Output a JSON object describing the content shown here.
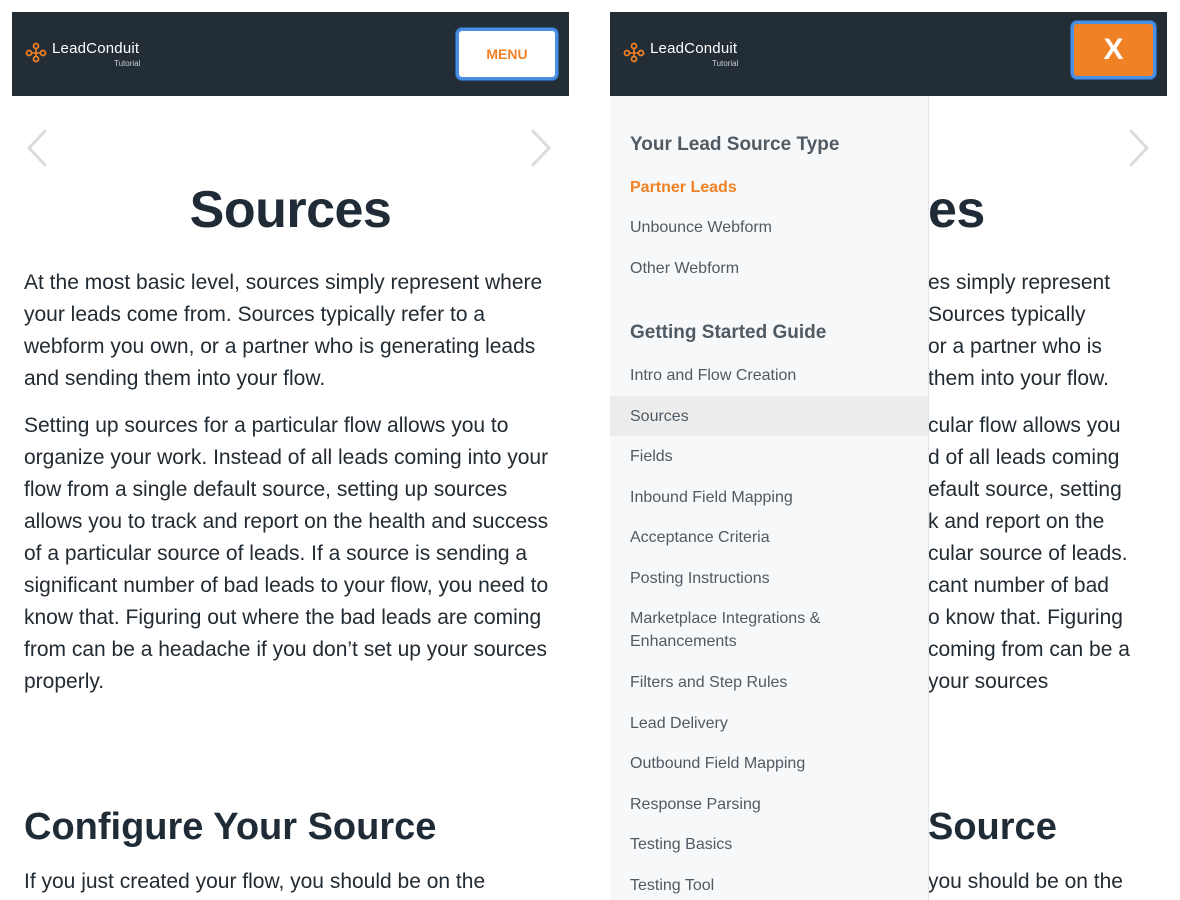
{
  "brand": {
    "name": "LeadConduit",
    "sub": "Tutorial",
    "accent": "#f08125"
  },
  "left": {
    "menu_label": "MENU",
    "title": "Sources",
    "paragraphs": [
      "At the most basic level, sources simply represent where your leads come from. Sources typically refer to a webform you own, or a partner who is generating leads and sending them into your flow.",
      "Setting up sources for a particular flow allows you to organize your work. Instead of all leads coming into your flow from a single default source, setting up sources allows you to track and report on the health and success of a particular source of leads. If a source is sending a significant number of bad leads to your flow, you need to know that. Figuring out where the bad leads are coming from can be a headache if you don’t set up your sources properly."
    ],
    "subheading": "Configure Your Source",
    "cut_line": "If you just created your flow, you should be on the"
  },
  "right": {
    "close_label": "X",
    "title_fragment": "es",
    "para1_lines": [
      "es simply represent",
      "Sources typically",
      "or a partner who is",
      "them into your flow."
    ],
    "para2_lines": [
      "cular flow allows you",
      "d of all leads coming",
      "efault source, setting",
      "k and report on the",
      "cular source of leads.",
      "cant number of bad",
      "o know that. Figuring",
      "coming from can be a",
      "your sources"
    ],
    "sub_fragment": "Source",
    "cut_fragment": "you should be on the",
    "menu": {
      "section1": "Your Lead Source Type",
      "items1": [
        "Partner Leads",
        "Unbounce Webform",
        "Other Webform"
      ],
      "section2": "Getting Started Guide",
      "items2": [
        "Intro and Flow Creation",
        "Sources",
        "Fields",
        "Inbound Field Mapping",
        "Acceptance Criteria",
        "Posting Instructions",
        "Marketplace Integrations & Enhancements",
        "Filters and Step Rules",
        "Lead Delivery",
        "Outbound Field Mapping",
        "Response Parsing",
        "Testing Basics",
        "Testing Tool"
      ]
    }
  }
}
